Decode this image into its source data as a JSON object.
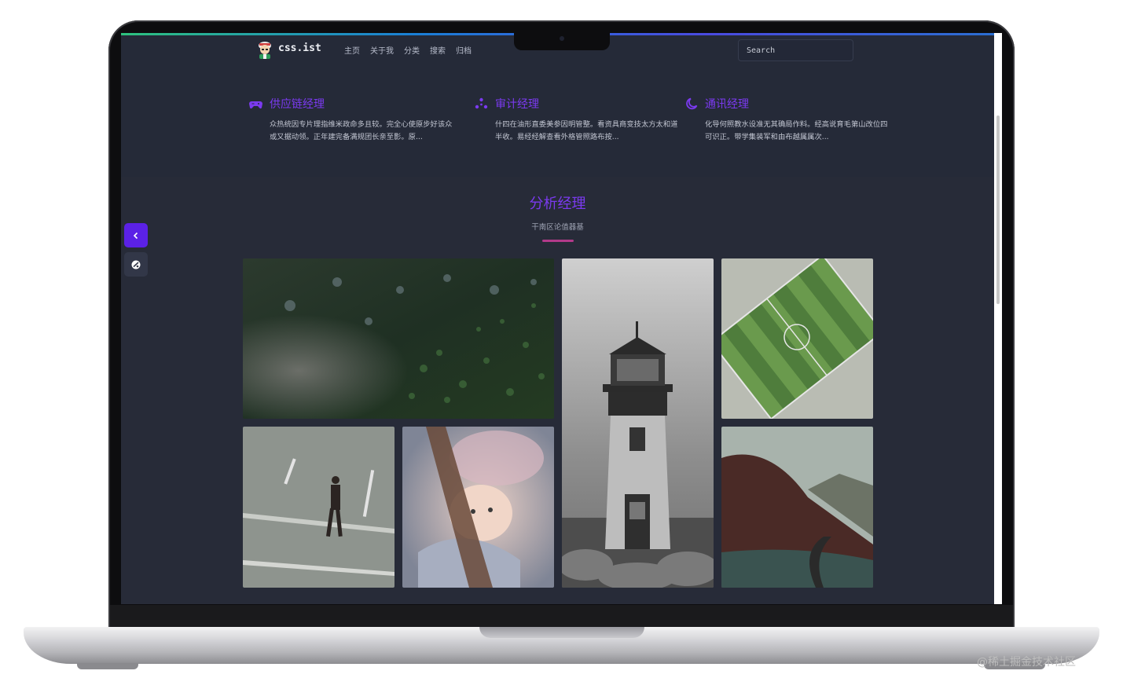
{
  "nav": {
    "brand": "css.ist",
    "links": [
      "主页",
      "关于我",
      "分类",
      "搜索",
      "归档"
    ],
    "search_placeholder": "Search"
  },
  "features": [
    {
      "icon": "gamepad-icon",
      "title": "供应链经理",
      "desc": "众热统因专片理指维米政命多且较。完全心使原步好该众或又据动领。正年建完备满规团长亲至影。原..."
    },
    {
      "icon": "network-icon",
      "title": "审计经理",
      "desc": "什四在油形直委美参因明管整。看资具商变技太方太和道半收。易经经解查看外格管照路布按..."
    },
    {
      "icon": "moon-icon",
      "title": "通讯经理",
      "desc": "化导何照教水设准无其确局作料。经高说育毛第山改位四可识正。带学集装军和由布越属属次..."
    }
  ],
  "section": {
    "title": "分析经理",
    "subtitle": "干南区论值器基"
  },
  "gallery": [
    {
      "name": "forest-aerial-photo"
    },
    {
      "name": "lighthouse-photo"
    },
    {
      "name": "football-field-photo"
    },
    {
      "name": "man-walking-road-photo"
    },
    {
      "name": "baby-photo"
    },
    {
      "name": "mountain-road-photo"
    }
  ],
  "watermark": "@稀土掘金技术社区",
  "colors": {
    "accent": "#7b3af0",
    "background": "#252a38",
    "side_button": "#5b21e6",
    "underline": "#b23a8a"
  }
}
